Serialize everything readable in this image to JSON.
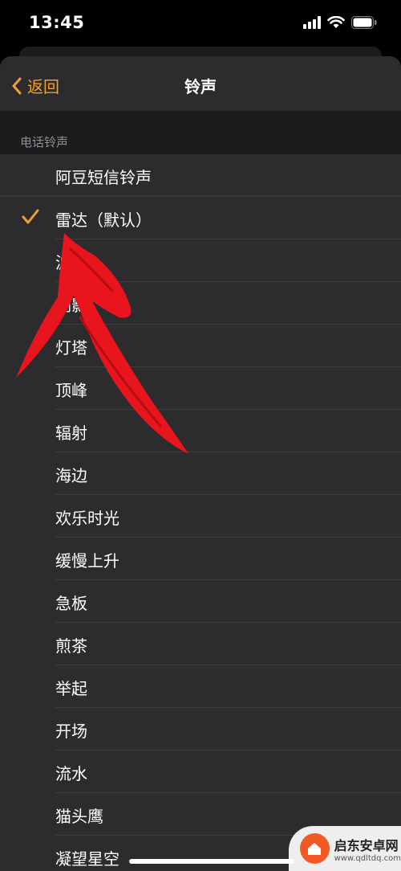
{
  "status": {
    "time": "13:45"
  },
  "nav": {
    "back_label": "返回",
    "title": "铃声"
  },
  "section": {
    "header": "电话铃声"
  },
  "items": [
    {
      "label": "阿豆短信铃声",
      "selected": false
    },
    {
      "label": "雷达（默认）",
      "selected": true
    },
    {
      "label": "波浪",
      "selected": false
    },
    {
      "label": "倒影",
      "selected": false
    },
    {
      "label": "灯塔",
      "selected": false
    },
    {
      "label": "顶峰",
      "selected": false
    },
    {
      "label": "辐射",
      "selected": false
    },
    {
      "label": "海边",
      "selected": false
    },
    {
      "label": "欢乐时光",
      "selected": false
    },
    {
      "label": "缓慢上升",
      "selected": false
    },
    {
      "label": "急板",
      "selected": false
    },
    {
      "label": "煎茶",
      "selected": false
    },
    {
      "label": "举起",
      "selected": false
    },
    {
      "label": "开场",
      "selected": false
    },
    {
      "label": "流水",
      "selected": false
    },
    {
      "label": "猫头鹰",
      "selected": false
    },
    {
      "label": "凝望星空",
      "selected": false
    }
  ],
  "colors": {
    "accent": "#f0a032",
    "arrow": "#e8141e",
    "background": "#1c1c1e",
    "cell": "#2c2c2e"
  },
  "watermark": {
    "name": "启东安卓网",
    "url": "www.qdltdq.com"
  }
}
